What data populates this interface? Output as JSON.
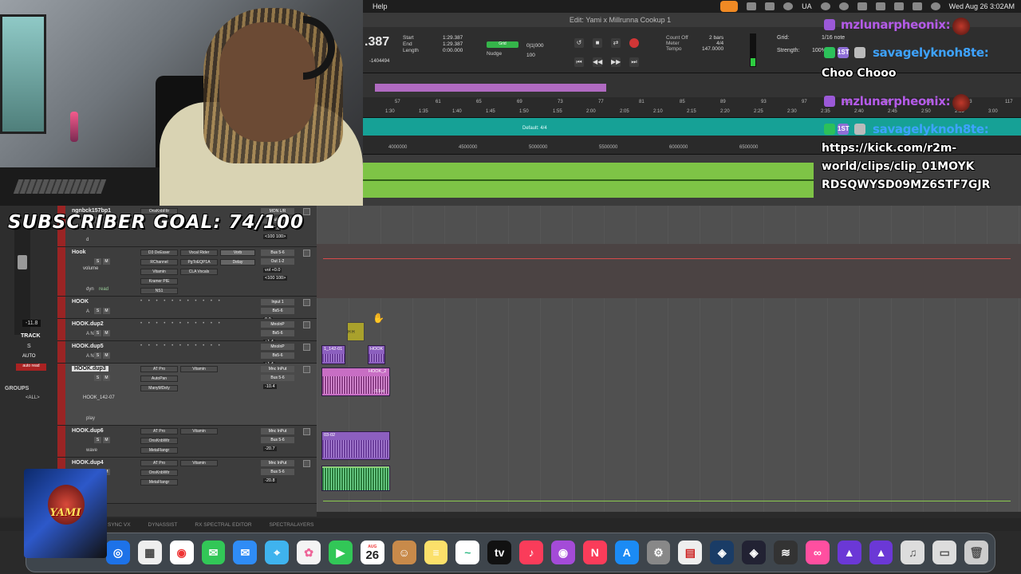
{
  "overlay": {
    "subscriber_goal": "SUBSCRIBER GOAL: 74/100",
    "logo_text": "YAMI"
  },
  "menubar": {
    "help": "Help",
    "region": "UA",
    "datetime": "Wed Aug 26  3:02AM"
  },
  "edit_window": {
    "title": "Edit: Yami x Millrunna Cookup 1"
  },
  "transport": {
    "main_counter": ".387",
    "start_label": "Start",
    "end_label": "End",
    "length_label": "Length",
    "start_val": "1:29.387",
    "end_val": "1:29.387",
    "length_val": "0:00.000",
    "samples_val": "-1404494",
    "grid_badge": "Grid",
    "nudge_label": "Nudge",
    "grid_value": "0|1|000",
    "nudge_value": "100",
    "count_off": "Count Off",
    "meter_label": "Meter",
    "tempo_label": "Tempo",
    "count_off_val": "2 bars",
    "meter_val": "4/4",
    "tempo_val": "147.0000",
    "grid_label": "Grid:",
    "grid_note": "1/16 note",
    "strength_label": "Strength:",
    "strength_val": "100%"
  },
  "rulers": {
    "bars": [
      "57",
      "61",
      "65",
      "69",
      "73",
      "77",
      "81",
      "85",
      "89",
      "93",
      "97",
      "101",
      "105",
      "109",
      "113",
      "117"
    ],
    "minsecs": [
      "1:30",
      "1:35",
      "1:40",
      "1:45",
      "1:50",
      "1:55",
      "2:00",
      "2:05",
      "2:10",
      "2:15",
      "2:20",
      "2:25",
      "2:30",
      "2:35",
      "2:40",
      "2:45",
      "2:50",
      "2:55",
      "3:00"
    ],
    "meter_marker": "Default: 4/4",
    "samples": [
      "4000000",
      "4500000",
      "5000000",
      "5500000",
      "6000000",
      "6500000"
    ]
  },
  "left_strip": {
    "value": "-11.8",
    "track": "TRACK",
    "s": "S",
    "auto": "AUTO",
    "red_label": "auto read",
    "groups": "GROUPS",
    "all": "<ALL>"
  },
  "tracks": [
    {
      "name": "ngnbck157bp1",
      "plugins": [
        "OnsKnbFltr"
      ],
      "io_in": "MON L/R",
      "io_out": "Out 1-2",
      "vol": "vol  -3.6",
      "pan": "<100  100>",
      "mode": "d"
    },
    {
      "name": "Hook",
      "plugins": [
        "D3 DeEsser",
        "RChannel",
        "Vitamin",
        "Kramer PIE",
        "NS1"
      ],
      "plugins2": [
        "Vocal Rider",
        "PgToEQP1A",
        "CLA Vocals"
      ],
      "sends": [
        "Vorb",
        "Delay"
      ],
      "io_in": "Bus 5-6",
      "io_out": "Out 1-2",
      "vol": "vol  +0.0",
      "pan": "<100  100>",
      "sub": "volume",
      "mode": "dyn",
      "rec": "read"
    },
    {
      "name": "HOOK",
      "io_in": "Input 1",
      "io_out": "Bs5-6",
      "vol": "0.0",
      "mode": "A"
    },
    {
      "name": "HOOK.dup2",
      "io_in": "MnoInP",
      "io_out": "Bs5-6",
      "vol": "+1.4",
      "mode": "A N"
    },
    {
      "name": "HOOK.dup5",
      "io_in": "MnoInP",
      "io_out": "Bs5-6",
      "vol": "+1.4",
      "mode": "A N"
    },
    {
      "name": "HOOK.dup3",
      "plugins": [
        "AT Pro",
        "AutoPan",
        "ManyMDely"
      ],
      "plugins2": [
        "Vitamin"
      ],
      "io_in": "Mnc InPut",
      "io_out": "Bus 5-6",
      "vol": "-10.4",
      "mode": "play",
      "sub": "HOOK_142-07"
    },
    {
      "name": "HOOK.dup6",
      "plugins": [
        "AT Pro",
        "OnsKnbWtr",
        "MetaFlangr"
      ],
      "plugins2": [
        "Vitamin"
      ],
      "io_in": "Mnc InPut",
      "io_out": "Bus 5-6",
      "vol": "-20.7",
      "mode": "wave"
    },
    {
      "name": "HOOK.dup4",
      "plugins": [
        "AT Pro",
        "OnsKnbWtr",
        "MetaFlangr"
      ],
      "plugins2": [
        "Vitamin"
      ],
      "io_in": "Mnc InPut",
      "io_out": "Bus 5-6",
      "vol": "-20.8",
      "mode": "wave"
    }
  ],
  "clips": {
    "c1": "1_142-01",
    "c2": "HOOK",
    "c3": "HOOK_2",
    "c4": "03-02",
    "c3_gain": "-7.5 d",
    "yellow": "H H"
  },
  "plugin_tabs": [
    "SYNC VX",
    "DYNASSIST",
    "RX SPECTRAL EDITOR",
    "SPECTRALAYERS"
  ],
  "chat": {
    "user1": "mzlunarpheonix:",
    "user2": "savagelyknoh8te:",
    "msg1": "Choo Chooo",
    "user3": "mzlunarpheonix:",
    "user4": "savagelyknoh8te:",
    "msg2_line1": "https://kick.com/r2m-",
    "msg2_line2": "world/clips/clip_01MOYK",
    "msg2_line3": "RDSQWYSD09MZ6STF7GJR",
    "badge_first": "1ST",
    "user_color_purple": "#b45be8",
    "user_color_blue": "#3ea3ff"
  },
  "dock": {
    "calendar_month": "AUG",
    "calendar_day": "26",
    "appletv": "tv"
  }
}
